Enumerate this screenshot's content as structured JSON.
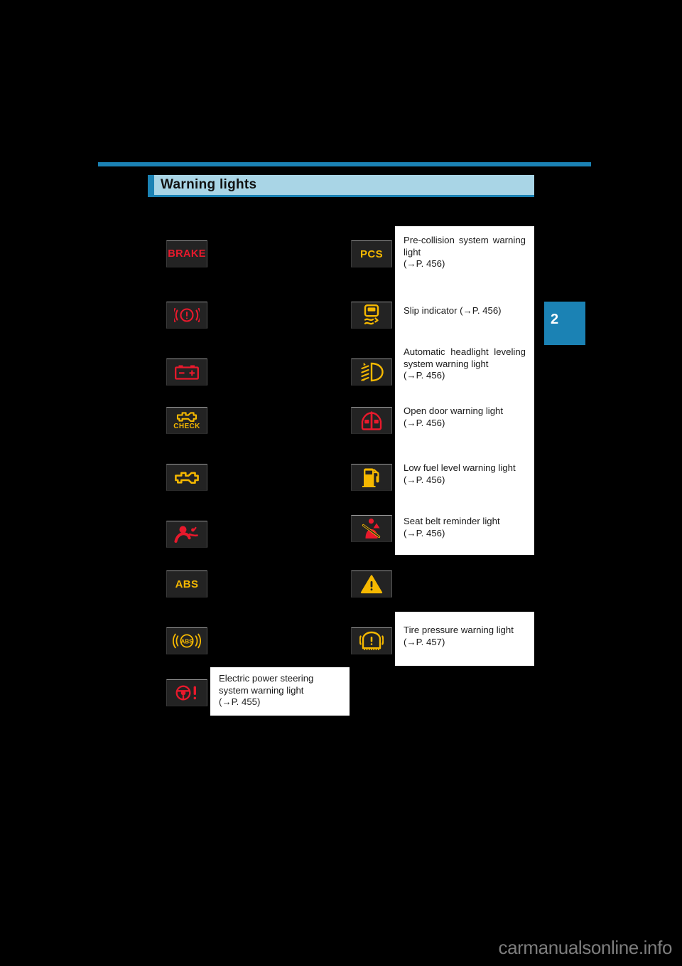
{
  "page": {
    "background_color": "#000000",
    "accent_color": "#1b82b4",
    "header_band_color": "#a9d5e6",
    "chapter_number": "2",
    "watermark": "carmanualsonline.info"
  },
  "header": {
    "title": "Warning lights"
  },
  "left_column": [
    {
      "icon": "brake-warning-light-icon",
      "label": "BRAKE",
      "color": "#e8192c"
    },
    {
      "icon": "brake-system-circle-exclamation-icon",
      "label": "",
      "color": "#e8192c"
    },
    {
      "icon": "charging-system-battery-icon",
      "label": "",
      "color": "#e8192c"
    },
    {
      "icon": "check-engine-check-icon",
      "label": "CHECK",
      "color": "#f5b800"
    },
    {
      "icon": "malfunction-indicator-engine-icon",
      "label": "",
      "color": "#f5b800"
    },
    {
      "icon": "srs-airbag-warning-icon",
      "label": "",
      "color": "#e8192c"
    },
    {
      "icon": "abs-warning-light-icon",
      "label": "ABS",
      "color": "#f5b800"
    },
    {
      "icon": "brake-assist-abs-circle-icon",
      "label": "ABS",
      "color": "#f5b800"
    },
    {
      "icon": "electric-power-steering-icon",
      "label": "",
      "color": "#e8192c"
    }
  ],
  "right_column": [
    {
      "icon": "pre-collision-pcs-icon",
      "label": "PCS",
      "color": "#f5b800"
    },
    {
      "icon": "slip-indicator-icon",
      "label": "",
      "color": "#f5b800"
    },
    {
      "icon": "automatic-headlight-leveling-icon",
      "label": "",
      "color": "#f5b800"
    },
    {
      "icon": "open-door-warning-icon",
      "label": "",
      "color": "#e8192c"
    },
    {
      "icon": "low-fuel-level-icon",
      "label": "",
      "color": "#f5b800"
    },
    {
      "icon": "seat-belt-reminder-icon",
      "label": "",
      "color": "#e8192c"
    },
    {
      "icon": "master-warning-triangle-icon",
      "label": "",
      "color": "#f5b800"
    },
    {
      "icon": "tire-pressure-warning-icon",
      "label": "",
      "color": "#f5b800"
    }
  ],
  "descriptions": {
    "pre_collision": "Pre-collision system warning light\n(→P. 456)",
    "slip_indicator": "Slip indicator (→P. 456)",
    "headlight_leveling": "Automatic headlight leveling system warning light\n(→P. 456)",
    "open_door": "Open door warning light\n(→P. 456)",
    "low_fuel": "Low fuel level warning light\n(→P. 456)",
    "seat_belt": "Seat belt reminder light\n(→P. 456)",
    "tire_pressure": "Tire pressure warning light\n(→P. 457)",
    "electric_power_steering": "Electric power steering system warning light\n(→P. 455)"
  }
}
